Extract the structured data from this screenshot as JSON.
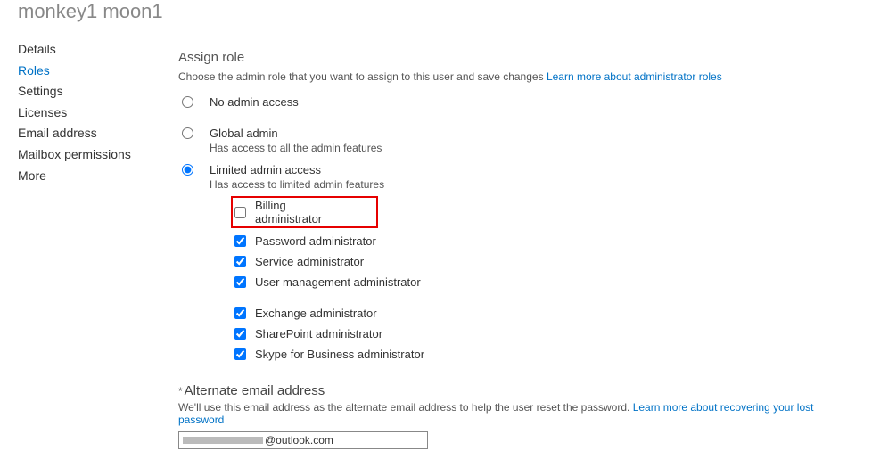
{
  "breadcrumb": "monkey1 moon1",
  "sidebar": {
    "items": [
      {
        "label": "Details"
      },
      {
        "label": "Roles"
      },
      {
        "label": "Settings"
      },
      {
        "label": "Licenses"
      },
      {
        "label": "Email address"
      },
      {
        "label": "Mailbox permissions"
      },
      {
        "label": "More"
      }
    ],
    "activeIndex": 1
  },
  "assignRole": {
    "title": "Assign role",
    "description": "Choose the admin role that you want to assign to this user and save changes",
    "learnMoreLabel": "Learn more about administrator roles",
    "options": {
      "noAccess": {
        "label": "No admin access"
      },
      "global": {
        "label": "Global admin",
        "sub": "Has access to all the admin features"
      },
      "limited": {
        "label": "Limited admin access",
        "sub": "Has access to limited admin features"
      }
    },
    "limitedRolesA": [
      {
        "label": "Billing administrator",
        "checked": false,
        "highlight": true
      },
      {
        "label": "Password administrator",
        "checked": true
      },
      {
        "label": "Service administrator",
        "checked": true
      },
      {
        "label": "User management administrator",
        "checked": true
      }
    ],
    "limitedRolesB": [
      {
        "label": "Exchange administrator",
        "checked": true
      },
      {
        "label": "SharePoint administrator",
        "checked": true
      },
      {
        "label": "Skype for Business administrator",
        "checked": true
      }
    ]
  },
  "altEmail": {
    "heading": "Alternate email address",
    "desc": "We'll use this email address as the alternate email address to help the user reset the password.",
    "learnMoreLabel": "Learn more about recovering your lost password",
    "domainSuffix": "@outlook.com"
  }
}
